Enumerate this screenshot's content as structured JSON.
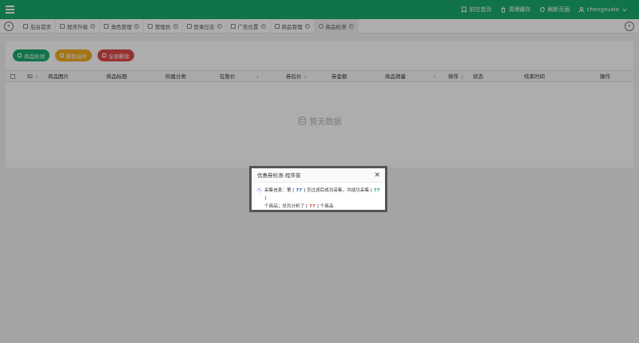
{
  "header": {
    "actions": [
      {
        "label": "前往首页",
        "icon": "bookmark-icon"
      },
      {
        "label": "清理缓存",
        "icon": "trash-icon"
      },
      {
        "label": "刷新页面",
        "icon": "refresh-icon"
      },
      {
        "label": "chengxuxia",
        "icon": "user-icon"
      }
    ]
  },
  "tabs": [
    {
      "label": "后台首页",
      "icon": "send-icon",
      "closable": false
    },
    {
      "label": "程序升级",
      "icon": "diamond-icon",
      "closable": true
    },
    {
      "label": "角色管理",
      "icon": "user-icon",
      "closable": true
    },
    {
      "label": "管理员",
      "icon": "user-circle-icon",
      "closable": true
    },
    {
      "label": "登录日志",
      "icon": "list-icon",
      "closable": true
    },
    {
      "label": "广告位置",
      "icon": "document-icon",
      "closable": true
    },
    {
      "label": "商品管理",
      "icon": "home-icon",
      "closable": true
    },
    {
      "label": "商品检测",
      "icon": "circle-icon",
      "closable": true,
      "active": true
    }
  ],
  "toolbar": {
    "detect_label": "商品检测",
    "delete_selected_label": "删除选中",
    "delete_all_label": "全部删除"
  },
  "table": {
    "columns": [
      "ID",
      "商品图片",
      "商品标题",
      "所属分类",
      "在售价",
      "券后价",
      "券金额",
      "商品销量",
      "排序",
      "状态",
      "结束时间",
      "操作"
    ],
    "empty_text": "暂无数据"
  },
  "dialog": {
    "title": "优惠券检测-程序侠",
    "msg_prefix": "采集信息：第 [",
    "page_num": "77",
    "msg_mid1": "] 页过滤后成功采集，共成功采集 [",
    "count_num": "77",
    "msg_mid2": "]",
    "msg_line2_prefix": "个商品；总共分析了 [",
    "total_num": "77",
    "msg_line2_suffix": "] 个商品"
  },
  "colors": {
    "brand_green": "#1aaa6c",
    "warning_yellow": "#f0ad1e",
    "danger_red": "#e04b4b"
  }
}
